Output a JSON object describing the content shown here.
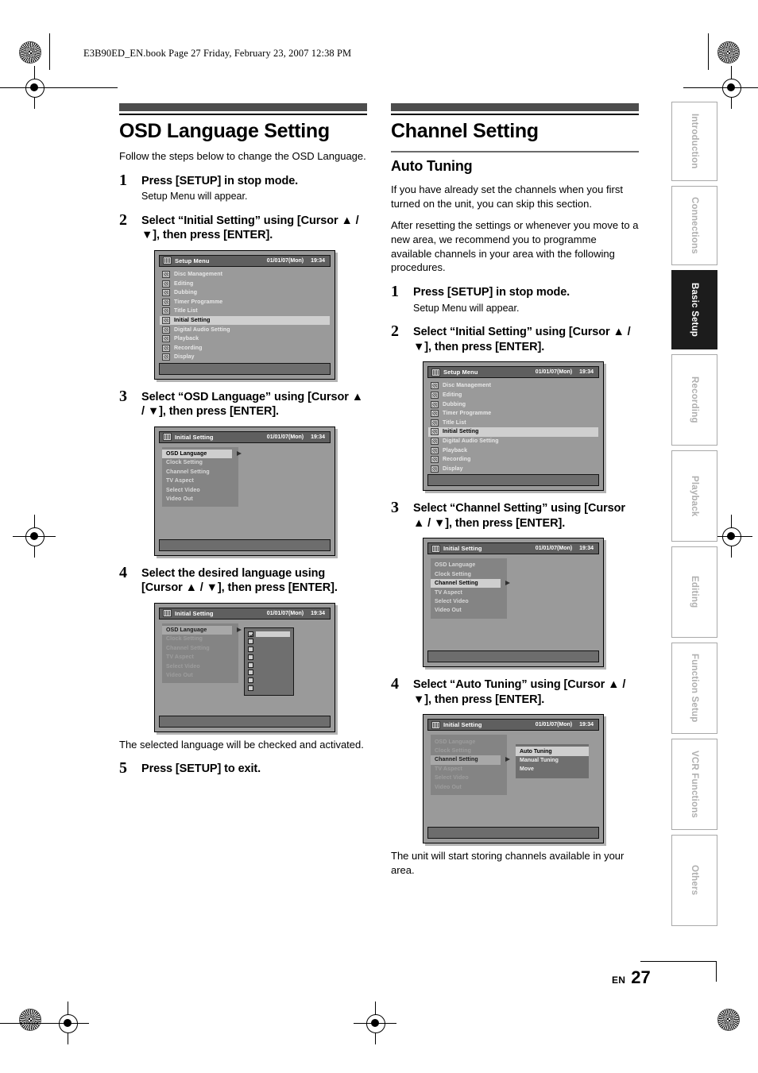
{
  "header": {
    "book_line": "E3B90ED_EN.book  Page 27  Friday, February 23, 2007  12:38 PM"
  },
  "left_column": {
    "section_title": "OSD Language Setting",
    "lead": "Follow the steps below to change the OSD Language.",
    "steps": [
      {
        "num": "1",
        "head": "Press [SETUP] in stop mode.",
        "note": "Setup Menu will appear."
      },
      {
        "num": "2",
        "head": "Select “Initial Setting” using [Cursor ▲ / ▼], then press [ENTER]."
      },
      {
        "num": "3",
        "head": "Select “OSD Language” using [Cursor ▲ / ▼], then press [ENTER]."
      },
      {
        "num": "4",
        "head": "Select the desired language using [Cursor ▲ / ▼], then press [ENTER].",
        "after": "The selected language will be checked and activated."
      },
      {
        "num": "5",
        "head": "Press [SETUP] to exit."
      }
    ]
  },
  "right_column": {
    "section_title": "Channel Setting",
    "subsection_title": "Auto Tuning",
    "para1": "If you have already set the channels when you first turned on the unit, you can skip this section.",
    "para2": "After resetting the settings or whenever you move to a new area, we recommend you to programme available channels in your area with the following procedures.",
    "steps": [
      {
        "num": "1",
        "head": "Press [SETUP] in stop mode.",
        "note": "Setup Menu will appear."
      },
      {
        "num": "2",
        "head": "Select “Initial Setting” using [Cursor ▲ / ▼], then press [ENTER]."
      },
      {
        "num": "3",
        "head": "Select “Channel Setting” using [Cursor ▲ / ▼], then press [ENTER]."
      },
      {
        "num": "4",
        "head": "Select “Auto Tuning” using [Cursor ▲ / ▼], then press [ENTER].",
        "after": "The unit will start storing channels available in your area."
      }
    ]
  },
  "osd": {
    "setup_menu": {
      "title": "Setup Menu",
      "date": "01/01/07(Mon)",
      "time": "19:34",
      "items": [
        "Disc Management",
        "Editing",
        "Dubbing",
        "Timer Programme",
        "Title List",
        "Initial Setting",
        "Digital Audio Setting",
        "Playback",
        "Recording",
        "Display"
      ],
      "selected": "Initial Setting"
    },
    "initial_setting": {
      "title": "Initial Setting",
      "date": "01/01/07(Mon)",
      "time": "19:34",
      "items": [
        "OSD Language",
        "Clock Setting",
        "Channel Setting",
        "TV Aspect",
        "Select Video",
        "Video Out"
      ],
      "selected_osd_language": "OSD Language",
      "selected_channel_setting": "Channel Setting"
    },
    "channel_submenu": {
      "items": [
        "Auto Tuning",
        "Manual Tuning",
        "Move"
      ],
      "selected": "Auto Tuning"
    }
  },
  "rail": {
    "tabs": [
      {
        "label": "Introduction",
        "active": false
      },
      {
        "label": "Connections",
        "active": false
      },
      {
        "label": "Basic Setup",
        "active": true
      },
      {
        "label": "Recording",
        "active": false
      },
      {
        "label": "Playback",
        "active": false
      },
      {
        "label": "Editing",
        "active": false
      },
      {
        "label": "Function Setup",
        "active": false
      },
      {
        "label": "VCR Functions",
        "active": false
      },
      {
        "label": "Others",
        "active": false
      }
    ]
  },
  "footer": {
    "lang_code": "EN",
    "page_number": "27"
  }
}
